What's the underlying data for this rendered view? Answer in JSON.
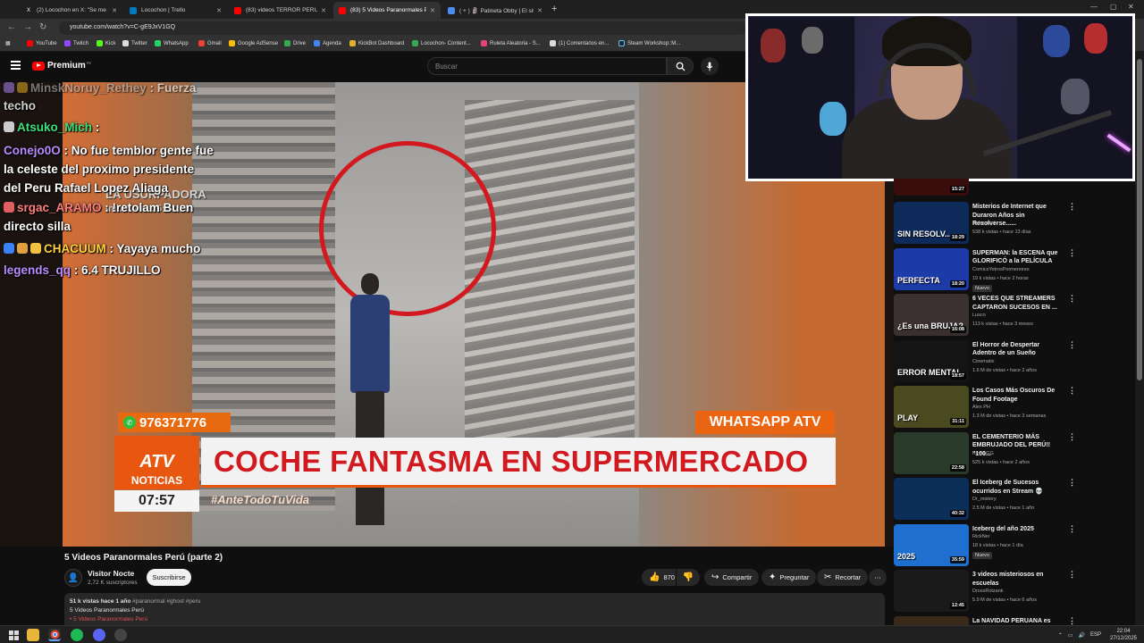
{
  "browser": {
    "tabs": [
      {
        "label": "(2) Locochon en X: \"Se me cay",
        "favicon": "x-icon",
        "active": false
      },
      {
        "label": "Locochon | Trello",
        "favicon": "trello-icon",
        "active": false
      },
      {
        "label": "(83) videos TERROR PERU - Yo",
        "favicon": "youtube-icon",
        "active": false
      },
      {
        "label": "(83) 5 Videos Paranormales Per",
        "favicon": "youtube-icon",
        "active": true
      },
      {
        "label": "( + ) 🗿 Patineta Obby | El sitio",
        "favicon": "roblox-icon",
        "active": false
      }
    ],
    "new_tab": "+",
    "url": "youtube.com/watch?v=C-gE9JxV1GQ",
    "bookmarks": [
      "YouTube",
      "Twitch",
      "Kick",
      "Twitter",
      "WhatsApp",
      "Gmail",
      "Google AdSense",
      "Drive",
      "Agenda",
      "KickBot Dashboard",
      "Locochon- Content...",
      "Ruleta Aleatoria - S...",
      "(1) Comentarios en...",
      "Steam Workshop::M..."
    ]
  },
  "youtube": {
    "logo_text": "Premium",
    "logo_sup": "PE",
    "search_placeholder": "Buscar"
  },
  "video_overlay": {
    "phone": "976371776",
    "whatsapp_label": "WHATSAPP ATV",
    "brand_mark": "ATV",
    "brand": "NOTICIAS",
    "headline": "COCHE FANTASMA EN SUPERMERCADO",
    "clock": "07:57",
    "hashtag": "#AnteTodoTuVida"
  },
  "chat": {
    "usurp_line1": "LA USURPADORA",
    "usurp_line2": "Inicia en: 05:02:28",
    "messages": [
      {
        "user": "MinskNoruy_Rethey",
        "user_color": "#b9b9b9",
        "text": ": Fuerza",
        "badge_colors": [
          "#9c7bdc",
          "#d0a020"
        ]
      },
      {
        "user": "",
        "user_color": "#cfcfcf",
        "text": "techo",
        "badge_colors": []
      },
      {
        "user": "Atsuko_Mich",
        "user_color": "#3ee07a",
        "text": ":",
        "badge_colors": [
          "#cccccc"
        ]
      },
      {
        "user": "Conejo0O",
        "user_color": "#b98cff",
        "text": ": No fue temblor gente fue",
        "badge_colors": []
      },
      {
        "user": "",
        "user_color": "#ffffff",
        "text": "la  celeste del proximo presidente",
        "badge_colors": []
      },
      {
        "user": "",
        "user_color": "#ffffff",
        "text": "del Peru Rafael Lopez Aliaga",
        "badge_colors": []
      },
      {
        "user": "srgac_ARAMO",
        "user_color": "#ff7f7f",
        "text": ": !retolam Buen",
        "badge_colors": [
          "#e06060"
        ]
      },
      {
        "user": "",
        "user_color": "#ffffff",
        "text": "directo silla",
        "badge_colors": []
      },
      {
        "user": "CHACUUM",
        "user_color": "#ffd23c",
        "text": ": Yayaya mucho",
        "badge_colors": [
          "#3b82f6",
          "#e0a040",
          "#f0c040"
        ]
      },
      {
        "user": "legends_qq",
        "user_color": "#b98cff",
        "text": ": 6.4 TRUJILLO",
        "badge_colors": []
      }
    ]
  },
  "video": {
    "title": "5 Videos Paranormales Perú (parte 2)",
    "channel": "Visitor Nocte",
    "subscribers": "2,72 K suscriptores",
    "subscribe_label": "Suscribirse",
    "likes": "870",
    "share_label": "Compartir",
    "ask_label": "Preguntar",
    "clip_label": "Recortar",
    "views_date": "51 k vistas  hace 1 año",
    "tags": "#paranormal #ghost #peru",
    "desc_line1": "5 Videos Paranormales Perú",
    "desc_line2": "• 5 Videos Paranormales Perú"
  },
  "recommendations": [
    {
      "title": "",
      "channel": "",
      "stats": "",
      "duration": "15:27",
      "is_new": false,
      "thumb": "#3a0d0d"
    },
    {
      "title": "Misterios de Internet que Duraron Años sin Resolverse......",
      "channel": "clubernaut",
      "stats": "538 k vistas  •  hace 13 días",
      "duration": "18:29",
      "is_new": false,
      "thumb": "#0d2a5a",
      "thumb_text": "SIN RESOLV..."
    },
    {
      "title": "SUPERMAN: la ESCENA que GLORIFICÓ a la PELÍCULA",
      "channel": "ComicsYotrosPormenores",
      "stats": "19 k vistas  •  hace 2 horas",
      "duration": "18:20",
      "is_new": true,
      "thumb": "#1c3aa8",
      "thumb_text": "PERFECTA"
    },
    {
      "title": "6 VECES QUE STREAMERS CAPTARON SUCESOS EN ...",
      "channel": "Lusco",
      "stats": "113 k vistas  •  hace 3 meses",
      "duration": "16:08",
      "is_new": false,
      "thumb": "#3a3030",
      "thumb_text": "¿Es una BRUJA?"
    },
    {
      "title": "El Horror de Despertar Adentro de un Sueño",
      "channel": "Cinematix",
      "stats": "1.6 M de vistas  •  hace 2 años",
      "duration": "18:57",
      "is_new": false,
      "thumb": "#141414",
      "thumb_text": "ERROR MENTAL"
    },
    {
      "title": "Los Casos Más Oscuros De Found Footage",
      "channel": "Alex PH",
      "stats": "1.3 M de vistas  •  hace 3 semanas",
      "duration": "31:11",
      "is_new": false,
      "thumb": "#4a4a20",
      "thumb_text": "PLAY"
    },
    {
      "title": "EL CEMENTERIO MÁS EMBRUJADO DEL PERÚ!! \"100...",
      "channel": "Kevin GG",
      "stats": "525 k vistas  •  hace 2 años",
      "duration": "22:58",
      "is_new": false,
      "thumb": "#2a3a2a",
      "thumb_text": ""
    },
    {
      "title": "El Iceberg de Sucesos ocurridos en Stream 💀",
      "channel": "Dr_mistery",
      "stats": "2.5 M de vistas  •  hace 1 año",
      "duration": "40:32",
      "is_new": false,
      "thumb": "#0c2f5a",
      "thumb_text": ""
    },
    {
      "title": "Iceberg del año 2025",
      "channel": "RickNer",
      "stats": "18 k vistas  •  hace 1 día",
      "duration": "35:59",
      "is_new": true,
      "thumb": "#1e6fd0",
      "thumb_text": "2025"
    },
    {
      "title": "3 videos misteriosos en escuelas",
      "channel": "DrossRotzank",
      "stats": "5.9 M de vistas  •  hace 6 años",
      "duration": "12:45",
      "is_new": false,
      "thumb": "#1a1a1a",
      "thumb_text": ""
    },
    {
      "title": "La NAVIDAD PERUANA es",
      "channel": "",
      "stats": "",
      "duration": "",
      "is_new": false,
      "thumb": "#3a2a1a",
      "thumb_text": ""
    }
  ],
  "rec_new_label": "Nuevo",
  "taskbar": {
    "lang": "ESP",
    "time": "22:04",
    "date": "27/12/2025"
  }
}
